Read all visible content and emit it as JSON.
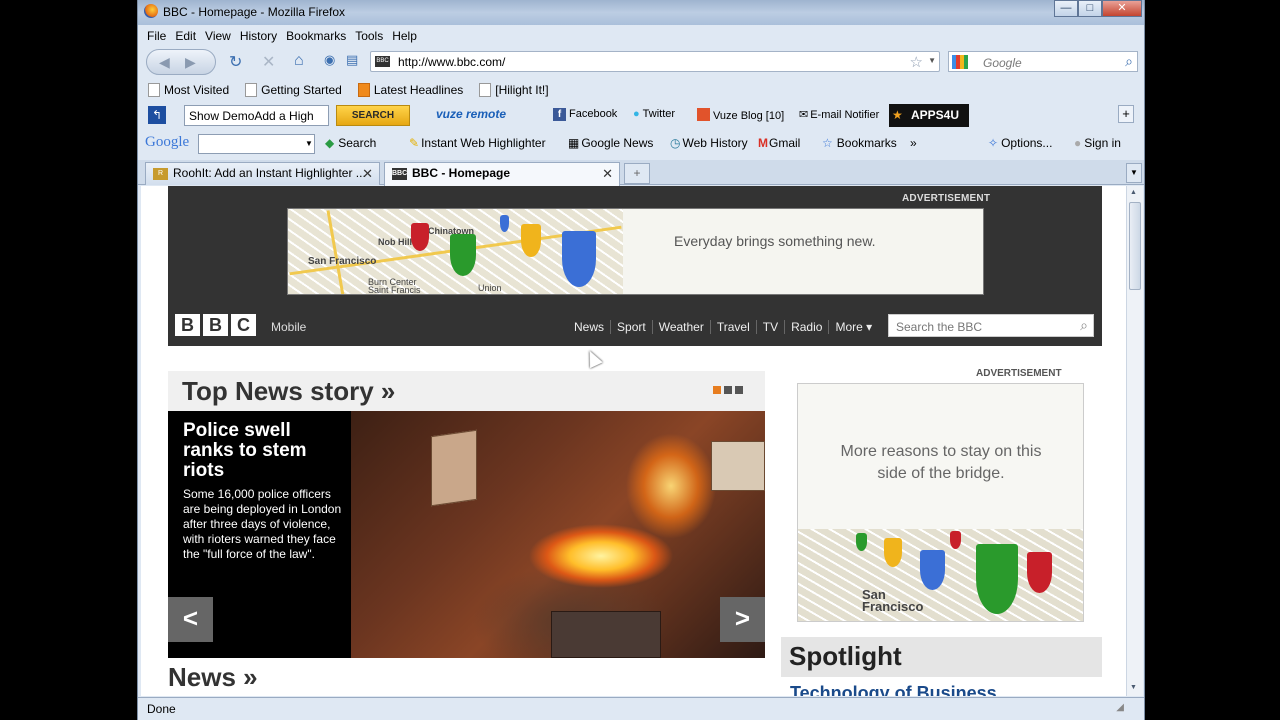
{
  "window": {
    "title": "BBC - Homepage - Mozilla Firefox",
    "min": "—",
    "max": "□",
    "close": "✕"
  },
  "menu": [
    "File",
    "Edit",
    "View",
    "History",
    "Bookmarks",
    "Tools",
    "Help"
  ],
  "nav": {
    "url": "http://www.bbc.com/",
    "site_badge": "BBC",
    "search_placeholder": "Google"
  },
  "bookmarks": [
    "Most Visited",
    "Getting Started",
    "Latest Headlines",
    "[Hilight It!]"
  ],
  "toolbar1": {
    "demo_select": "Show DemoAdd a High",
    "search_button": "SEARCH",
    "vuze": "vuze remote",
    "facebook": "Facebook",
    "twitter": "Twitter",
    "vuze_blog": "Vuze Blog [10]",
    "email": "E-mail Notifier",
    "apps": "APPS4U"
  },
  "toolbar2": {
    "google": "Google",
    "search": "Search",
    "highlighter": "Instant Web Highlighter",
    "google_news": "Google News",
    "web_history": "Web History",
    "gmail": "Gmail",
    "bookmarks": "Bookmarks",
    "more": "»",
    "options": "Options...",
    "sign_in": "Sign in"
  },
  "tabs": [
    {
      "label": "RoohIt: Add an Instant Highlighter ...",
      "active": false
    },
    {
      "label": "BBC - Homepage",
      "active": true
    }
  ],
  "status": "Done",
  "bbc": {
    "ad_label": "ADVERTISEMENT",
    "top_ad_tagline": "Everyday brings something new.",
    "map_labels": [
      "Chinatown",
      "San Francisco",
      "Nob Hill",
      "Burn Center",
      "Saint Francis",
      "Union"
    ],
    "logo": [
      "B",
      "B",
      "C"
    ],
    "mobile": "Mobile",
    "nav": [
      "News",
      "Sport",
      "Weather",
      "Travel",
      "TV",
      "Radio",
      "More ▾"
    ],
    "search_placeholder": "Search the BBC",
    "top_news_title": "Top News story »",
    "story_headline": "Police swell ranks to stem riots",
    "story_summary": "Some 16,000 police officers are being deployed in London after three days of violence, with rioters warned they face the \"full force of the law\".",
    "prev": "<",
    "next": ">",
    "news_title": "News »",
    "side_ad_label": "ADVERTISEMENT",
    "side_ad_tagline": "More reasons to stay on this side of the bridge.",
    "side_map_label": "San Francisco",
    "spotlight_title": "Spotlight",
    "spotlight_link": "Technology of Business"
  }
}
